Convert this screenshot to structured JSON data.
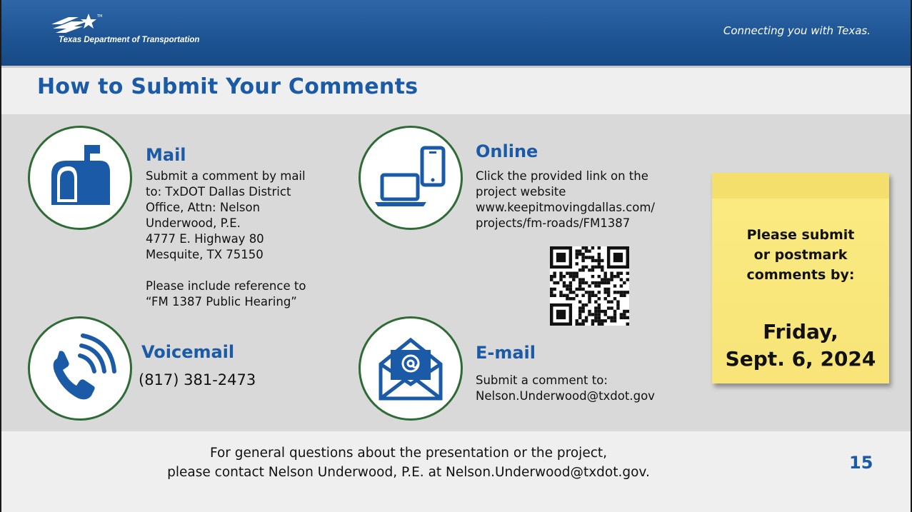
{
  "header": {
    "logo_text": "Texas Department of Transportation",
    "tagline": "Connecting you with Texas."
  },
  "title": "How to Submit Your Comments",
  "mail": {
    "title": "Mail",
    "text": "Submit a comment by mail\nto: TxDOT Dallas District\nOffice, Attn: Nelson\nUnderwood, P.E.\n4777 E. Highway 80\nMesquite, TX 75150\n\nPlease include reference to\n“FM 1387 Public Hearing”"
  },
  "online": {
    "title": "Online",
    "text": "Click the provided link on the\nproject website\nwww.keepitmovingdallas.com/\nprojects/fm-roads/FM1387"
  },
  "voicemail": {
    "title": "Voicemail",
    "phone": "(817) 381-2473"
  },
  "email": {
    "title": "E-mail",
    "text": "Submit a comment to:\nNelson.Underwood@txdot.gov"
  },
  "note": {
    "submit_text": "Please submit\nor postmark\ncomments by:",
    "date": "Friday,\nSept. 6, 2024"
  },
  "footer": {
    "text": "For general questions about the presentation or the project,\nplease contact Nelson Underwood, P.E. at Nelson.Underwood@txdot.gov.",
    "page_number": "15"
  },
  "colors": {
    "header_blue": "#1e5493",
    "title_blue": "#1b5aa6",
    "circle_border": "#2e6b35",
    "note_yellow": "#faeb82"
  },
  "icons": [
    "mailbox-icon",
    "devices-icon",
    "phone-icon",
    "email-envelope-icon",
    "qr-code"
  ]
}
